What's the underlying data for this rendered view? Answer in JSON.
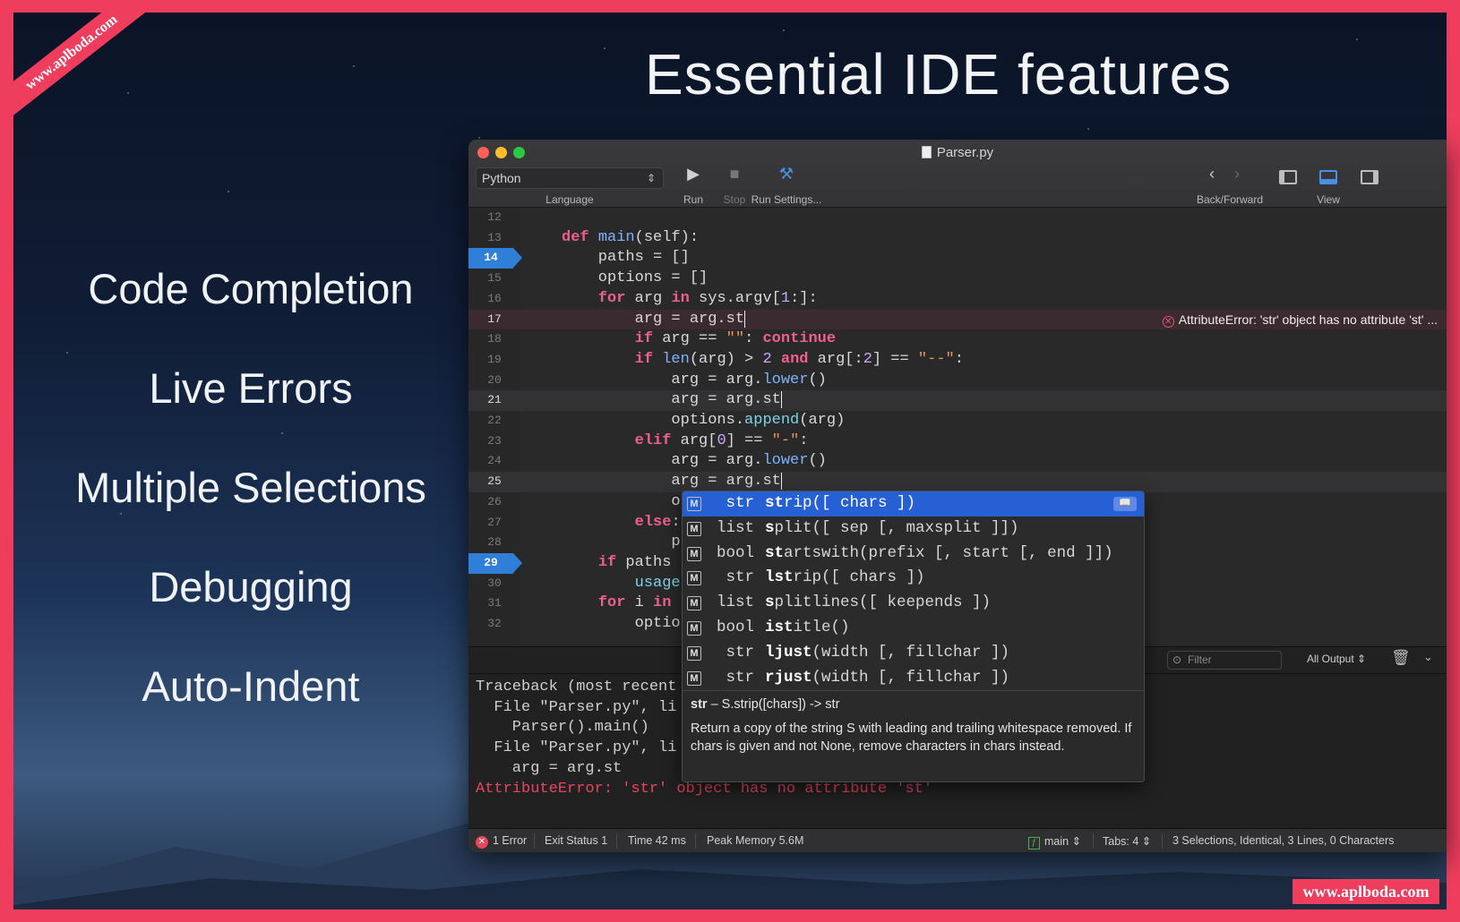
{
  "watermark_top": "www.aplboda.com",
  "watermark_bottom": "www.aplboda.com",
  "headline": "Essential IDE features",
  "features": [
    "Code Completion",
    "Live Errors",
    "Multiple Selections",
    "Debugging",
    "Auto-Indent"
  ],
  "window": {
    "title": "Parser.py",
    "language_value": "Python",
    "language_label": "Language",
    "run_label": "Run",
    "stop_label": "Stop",
    "run_settings_label": "Run Settings...",
    "back_forward_label": "Back/Forward",
    "view_label": "View"
  },
  "editor": {
    "line_numbers": [
      "12",
      "13",
      "14",
      "15",
      "16",
      "17",
      "18",
      "19",
      "20",
      "21",
      "22",
      "23",
      "24",
      "25",
      "26",
      "27",
      "28",
      "29",
      "30",
      "31",
      "32"
    ],
    "breakpoint_lines": [
      "14",
      "29"
    ],
    "error_message": "AttributeError: 'str' object has no attribute 'st' ...",
    "code": [
      "",
      "def main(self):",
      "    paths = []",
      "    options = []",
      "    for arg in sys.argv[1:]:",
      "        arg = arg.st",
      "        if arg == \"\": continue",
      "        if len(arg) > 2 and arg[:2] == \"--\":",
      "            arg = arg.lower()",
      "            arg = arg.st",
      "            options.append(arg)",
      "        elif arg[0] == \"-\":",
      "            arg = arg.lower()",
      "            arg = arg.st",
      "            o",
      "        else:",
      "            p",
      "    if paths",
      "        usage",
      "    for i in",
      "        optio"
    ]
  },
  "completion": {
    "items": [
      {
        "ret": "str",
        "bold": "st",
        "rest": "rip([ chars ])"
      },
      {
        "ret": "list",
        "bold": "s",
        "rest": "plit([ sep [, maxsplit ]])"
      },
      {
        "ret": "bool",
        "bold": "st",
        "rest": "artswith(prefix [, start [, end ]])"
      },
      {
        "ret": "str",
        "bold": "lst",
        "rest": "rip([ chars ])"
      },
      {
        "ret": "list",
        "bold": "s",
        "rest": "plitlines([ keepends ])"
      },
      {
        "ret": "bool",
        "bold": "ist",
        "rest": "itle()"
      },
      {
        "ret": "str",
        "bold": "ljust",
        "rest": "(width [, fillchar ])"
      },
      {
        "ret": "str",
        "bold": "rjust",
        "rest": "(width [, fillchar ])"
      }
    ],
    "kind": "M",
    "doc_head_bold": "str",
    "doc_head_rest": " – S.strip([chars]) -> str",
    "doc_body": "Return a copy of the string S with leading and trailing whitespace removed. If chars is given and not None, remove characters in chars instead."
  },
  "console": {
    "filter_placeholder": "Filter",
    "output_select": "All Output",
    "lines": [
      "Traceback (most recent",
      "  File \"Parser.py\", li",
      "    Parser().main()",
      "  File \"Parser.py\", li",
      "    arg = arg.st",
      "AttributeError: 'str' object has no attribute 'st'"
    ]
  },
  "status": {
    "errors": "1 Error",
    "exit_status": "Exit Status 1",
    "time": "Time 42 ms",
    "memory": "Peak Memory 5.6M",
    "function": "main",
    "tabs": "Tabs: 4",
    "selections": "3 Selections, Identical, 3 Lines, 0 Characters"
  },
  "colors": {
    "frame": "#ee3d5d",
    "accent": "#2f7fd8",
    "error": "#e8465c"
  }
}
